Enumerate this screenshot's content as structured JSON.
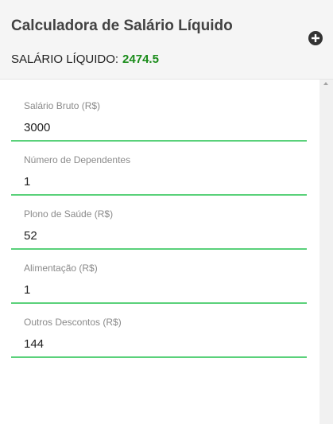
{
  "header": {
    "title": "Calculadora de Salário Líquido",
    "result_label": "SALÁRIO LÍQUIDO:",
    "result_value": "2474.5",
    "result_color": "#1a8c1a",
    "add_icon": "plus-circle-icon"
  },
  "fields": [
    {
      "label": "Salário Bruto (R$)",
      "value": "3000"
    },
    {
      "label": "Número de Dependentes",
      "value": "1"
    },
    {
      "label": "Plono de Saúde (R$)",
      "value": "52"
    },
    {
      "label": "Alimentação (R$)",
      "value": "1"
    },
    {
      "label": "Outros Descontos (R$)",
      "value": "144"
    }
  ],
  "colors": {
    "accent_underline": "#5ad17a",
    "header_background": "#f5f5f5"
  }
}
